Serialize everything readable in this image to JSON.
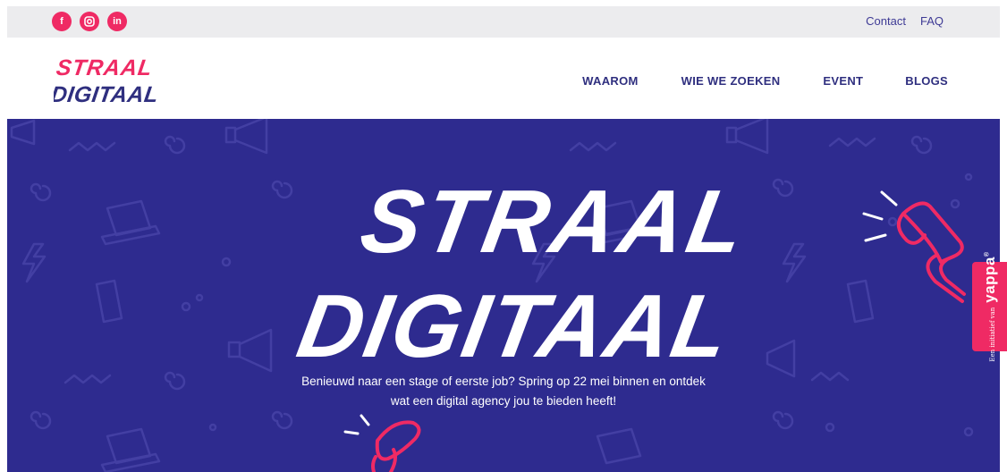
{
  "colors": {
    "brand_pink": "#ef2a64",
    "brand_blue": "#2e2b8f",
    "nav_text": "#2f2f7f",
    "topbar_bg": "#ececee"
  },
  "social": [
    {
      "icon": "facebook-icon",
      "glyph": "f"
    },
    {
      "icon": "instagram-icon",
      "glyph": "◘"
    },
    {
      "icon": "linkedin-icon",
      "glyph": "in"
    }
  ],
  "utility_links": {
    "contact": "Contact",
    "faq": "FAQ"
  },
  "logo": {
    "line1": "STRAAL",
    "line2": "DIGITAAL"
  },
  "nav": {
    "item1": "WAAROM",
    "item2": "WIE WE ZOEKEN",
    "item3": "EVENT",
    "item4": "BLOGS"
  },
  "hero": {
    "title_line1": "STRAAL",
    "title_line2": "DIGITAAL",
    "text_line1": "Benieuwd naar een stage of eerste job? Spring op 22 mei binnen en ontdek",
    "text_line2": "wat een digital agency jou te bieden heeft!"
  },
  "side_tab": {
    "prefix": "Een initiatief van",
    "brand": "yappa",
    "mark": "®"
  }
}
